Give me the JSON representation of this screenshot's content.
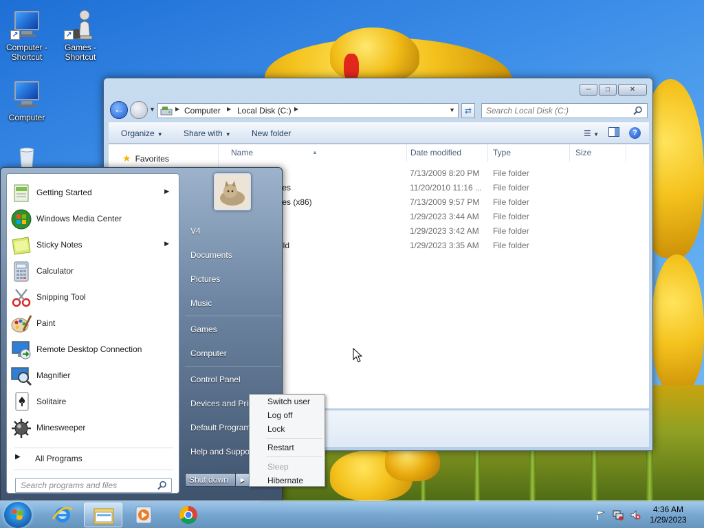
{
  "desktop": {
    "icons": [
      {
        "label": "Computer - Shortcut"
      },
      {
        "label": "Games - Shortcut"
      },
      {
        "label": "Computer"
      }
    ]
  },
  "explorer": {
    "breadcrumbs": [
      "Computer",
      "Local Disk (C:)"
    ],
    "search_placeholder": "Search Local Disk (C:)",
    "commands": {
      "organize": "Organize",
      "share_with": "Share with",
      "new_folder": "New folder"
    },
    "nav_pane": {
      "favorites": "Favorites"
    },
    "columns": [
      "Name",
      "Date modified",
      "Type",
      "Size"
    ],
    "rows": [
      {
        "name": "",
        "date": "7/13/2009 8:20 PM",
        "type": "File folder"
      },
      {
        "name": "iles",
        "date": "11/20/2010 11:16 ...",
        "type": "File folder"
      },
      {
        "name": "iles (x86)",
        "date": "7/13/2009 9:57 PM",
        "type": "File folder"
      },
      {
        "name": "",
        "date": "1/29/2023 3:44 AM",
        "type": "File folder"
      },
      {
        "name": "",
        "date": "1/29/2023 3:42 AM",
        "type": "File folder"
      },
      {
        "name": "old",
        "date": "1/29/2023 3:35 AM",
        "type": "File folder"
      }
    ]
  },
  "start_menu": {
    "programs": [
      {
        "label": "Getting Started",
        "submenu": true,
        "icon": "getting-started-icon"
      },
      {
        "label": "Windows Media Center",
        "submenu": false,
        "icon": "media-center-icon"
      },
      {
        "label": "Sticky Notes",
        "submenu": true,
        "icon": "sticky-notes-icon"
      },
      {
        "label": "Calculator",
        "submenu": false,
        "icon": "calculator-icon"
      },
      {
        "label": "Snipping Tool",
        "submenu": false,
        "icon": "snipping-tool-icon"
      },
      {
        "label": "Paint",
        "submenu": false,
        "icon": "paint-icon"
      },
      {
        "label": "Remote Desktop Connection",
        "submenu": false,
        "icon": "remote-desktop-icon"
      },
      {
        "label": "Magnifier",
        "submenu": false,
        "icon": "magnifier-icon"
      },
      {
        "label": "Solitaire",
        "submenu": false,
        "icon": "solitaire-icon"
      },
      {
        "label": "Minesweeper",
        "submenu": false,
        "icon": "minesweeper-icon"
      }
    ],
    "all_programs": "All Programs",
    "search_placeholder": "Search programs and files",
    "right_links": {
      "user": "V4",
      "documents": "Documents",
      "pictures": "Pictures",
      "music": "Music",
      "games": "Games",
      "computer": "Computer",
      "control_panel": "Control Panel",
      "devices": "Devices and Prin",
      "default_programs": "Default Program",
      "help": "Help and Suppo"
    },
    "shutdown_label": "Shut down"
  },
  "power_menu": {
    "items": [
      {
        "label": "Switch user",
        "enabled": true
      },
      {
        "label": "Log off",
        "enabled": true
      },
      {
        "label": "Lock",
        "enabled": true
      },
      {
        "label": "Restart",
        "enabled": true
      },
      {
        "label": "Sleep",
        "enabled": false
      },
      {
        "label": "Hibernate",
        "enabled": true
      }
    ]
  },
  "taskbar": {
    "time": "4:36 AM",
    "date": "1/29/2023",
    "pinned": [
      "internet-explorer-icon",
      "windows-explorer-icon",
      "media-player-icon",
      "chrome-icon"
    ],
    "tray": [
      "action-center-flag-icon",
      "network-icon",
      "volume-muted-icon"
    ]
  },
  "colors": {
    "taskbar": "#7aa5cc",
    "start_menu_right": "#4f6580",
    "tulip_yellow": "#f4c21d",
    "sky": "#3d8ee8"
  }
}
